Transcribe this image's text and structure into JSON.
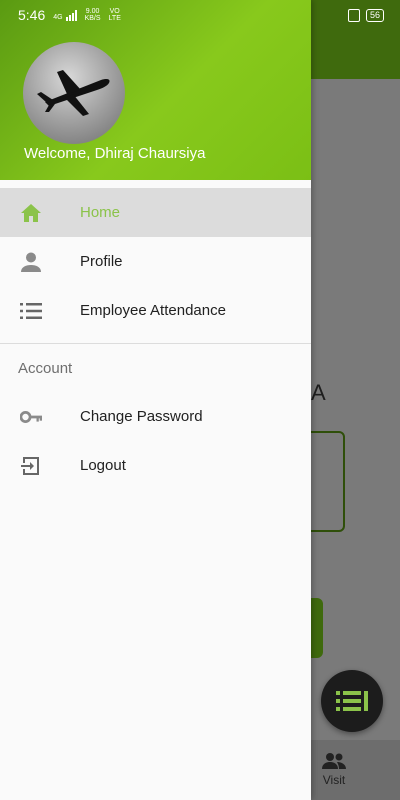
{
  "status_bar": {
    "time": "5:46",
    "network_speed": "9.00",
    "network_unit": "KB/S",
    "volte_top": "VO",
    "volte_bottom": "LTE",
    "signal_label": "4G",
    "battery": "56"
  },
  "drawer": {
    "welcome_text": "Welcome, Dhiraj Chaursiya",
    "items": [
      {
        "label": "Home",
        "icon": "home-icon",
        "active": true
      },
      {
        "label": "Profile",
        "icon": "person-icon",
        "active": false
      },
      {
        "label": "Employee Attendance",
        "icon": "list-icon",
        "active": false
      }
    ],
    "section_title": "Account",
    "account_items": [
      {
        "label": "Change Password",
        "icon": "key-icon"
      },
      {
        "label": "Logout",
        "icon": "logout-icon"
      }
    ]
  },
  "background": {
    "partial_heading": "A",
    "bottom_nav_visit": "Visit"
  },
  "colors": {
    "accent": "#8bc34a",
    "header_gradient_start": "#5a9a12",
    "header_gradient_end": "#88c91c"
  }
}
